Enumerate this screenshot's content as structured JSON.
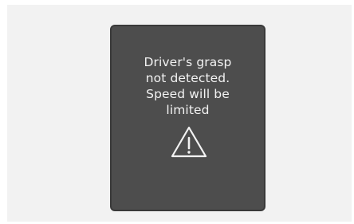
{
  "warning_panel": {
    "message_lines": [
      "Driver's grasp",
      "not detected.",
      "Speed will be",
      "limited"
    ],
    "icon": "warning-triangle-icon"
  },
  "colors": {
    "panel_background": "#4d4d4d",
    "text": "#f2f2f2",
    "page_background": "#f2f2f2"
  }
}
